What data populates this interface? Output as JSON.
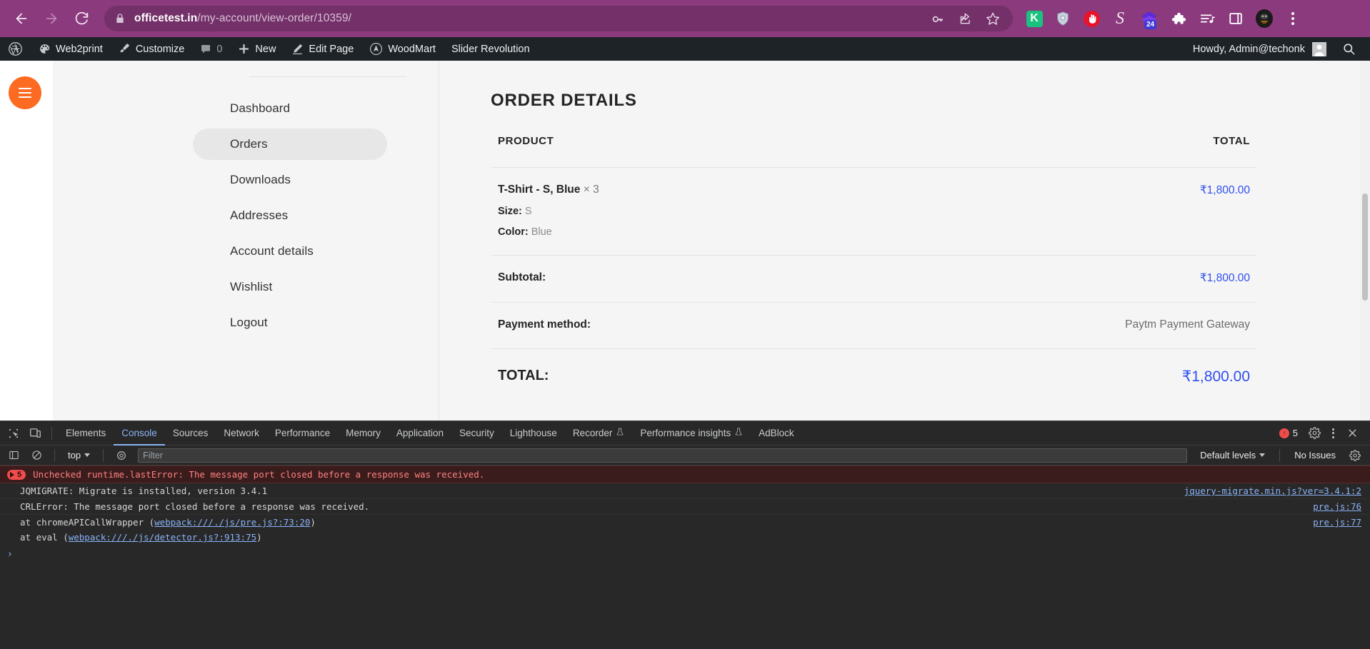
{
  "browser": {
    "url_bold": "officetest.in",
    "url_rest": "/my-account/view-order/10359/",
    "back_label": "Back",
    "forward_label": "Forward",
    "reload_label": "Reload",
    "lock_label": "View site information",
    "omni_icons": [
      "key-icon",
      "share-icon",
      "bookmark-star-icon"
    ],
    "extensions": [
      {
        "name": "kite-extension",
        "label": "K"
      },
      {
        "name": "shield-extension",
        "label": ""
      },
      {
        "name": "adblock-stop-extension",
        "label": ""
      },
      {
        "name": "script-s-extension",
        "label": "S"
      },
      {
        "name": "todoist-extension",
        "label": "24"
      },
      {
        "name": "puzzle-extensions-menu",
        "label": ""
      },
      {
        "name": "media-playlist-icon",
        "label": ""
      },
      {
        "name": "side-panel-icon",
        "label": ""
      },
      {
        "name": "profile-avatar",
        "label": ""
      },
      {
        "name": "chrome-menu",
        "label": ""
      }
    ]
  },
  "adminbar": {
    "items": [
      {
        "icon": "wordpress-logo-icon",
        "label": ""
      },
      {
        "icon": "palette-icon",
        "label": "Web2print"
      },
      {
        "icon": "brush-icon",
        "label": "Customize"
      },
      {
        "icon": "comment-icon",
        "label": "0"
      },
      {
        "icon": "plus-icon",
        "label": "New"
      },
      {
        "icon": "pencil-icon",
        "label": "Edit Page"
      },
      {
        "icon": "woodmart-icon",
        "label": "WoodMart"
      },
      {
        "icon": "",
        "label": "Slider Revolution"
      }
    ],
    "howdy": "Howdy, Admin@techonk",
    "avatar_name": "user-avatar",
    "search_label": "Search"
  },
  "account_nav": {
    "items": [
      {
        "label": "Dashboard",
        "active": false
      },
      {
        "label": "Orders",
        "active": true
      },
      {
        "label": "Downloads",
        "active": false
      },
      {
        "label": "Addresses",
        "active": false
      },
      {
        "label": "Account details",
        "active": false
      },
      {
        "label": "Wishlist",
        "active": false
      },
      {
        "label": "Logout",
        "active": false
      }
    ]
  },
  "order": {
    "title": "ORDER DETAILS",
    "col_product": "PRODUCT",
    "col_total": "TOTAL",
    "item": {
      "name": "T-Shirt - S, Blue",
      "qty": "× 3",
      "meta": [
        {
          "label": "Size:",
          "value": "S"
        },
        {
          "label": "Color:",
          "value": "Blue"
        }
      ],
      "total": "₹1,800.00"
    },
    "subtotal_label": "Subtotal:",
    "subtotal_value": "₹1,800.00",
    "payment_label": "Payment method:",
    "payment_value": "Paytm Payment Gateway",
    "total_label": "TOTAL:",
    "total_value": "₹1,800.00",
    "price_color": "#2f4ff0"
  },
  "devtools": {
    "tabs": [
      {
        "label": "Elements",
        "active": false,
        "beta": false
      },
      {
        "label": "Console",
        "active": true,
        "beta": false
      },
      {
        "label": "Sources",
        "active": false,
        "beta": false
      },
      {
        "label": "Network",
        "active": false,
        "beta": false
      },
      {
        "label": "Performance",
        "active": false,
        "beta": false
      },
      {
        "label": "Memory",
        "active": false,
        "beta": false
      },
      {
        "label": "Application",
        "active": false,
        "beta": false
      },
      {
        "label": "Security",
        "active": false,
        "beta": false
      },
      {
        "label": "Lighthouse",
        "active": false,
        "beta": false
      },
      {
        "label": "Recorder",
        "active": false,
        "beta": true
      },
      {
        "label": "Performance insights",
        "active": false,
        "beta": true
      },
      {
        "label": "AdBlock",
        "active": false,
        "beta": false
      }
    ],
    "error_count": "5",
    "context": "top",
    "filter_placeholder": "Filter",
    "levels_label": "Default levels",
    "no_issues": "No Issues",
    "settings_label": "Settings",
    "more_label": "More options",
    "close_label": "Close DevTools",
    "messages": [
      {
        "type": "error-group",
        "count": "5",
        "text": "Unchecked runtime.lastError: The message port closed before a response was received.",
        "source": ""
      },
      {
        "type": "log",
        "text": "JQMIGRATE: Migrate is installed, version 3.4.1",
        "source": "jquery-migrate.min.js?ver=3.4.1:2"
      },
      {
        "type": "log",
        "text": "CRLError: The message port closed before a response was received.",
        "source": "pre.js:76"
      },
      {
        "type": "stack",
        "text_prefix": "at chromeAPICallWrapper (",
        "text_link": "webpack:///./js/pre.js?:73:20",
        "text_suffix": ")",
        "source": "pre.js:77"
      },
      {
        "type": "stack",
        "text_prefix": "at eval (",
        "text_link": "webpack:///./js/detector.js?:913:75",
        "text_suffix": ")",
        "source": ""
      }
    ],
    "prompt": "›"
  }
}
